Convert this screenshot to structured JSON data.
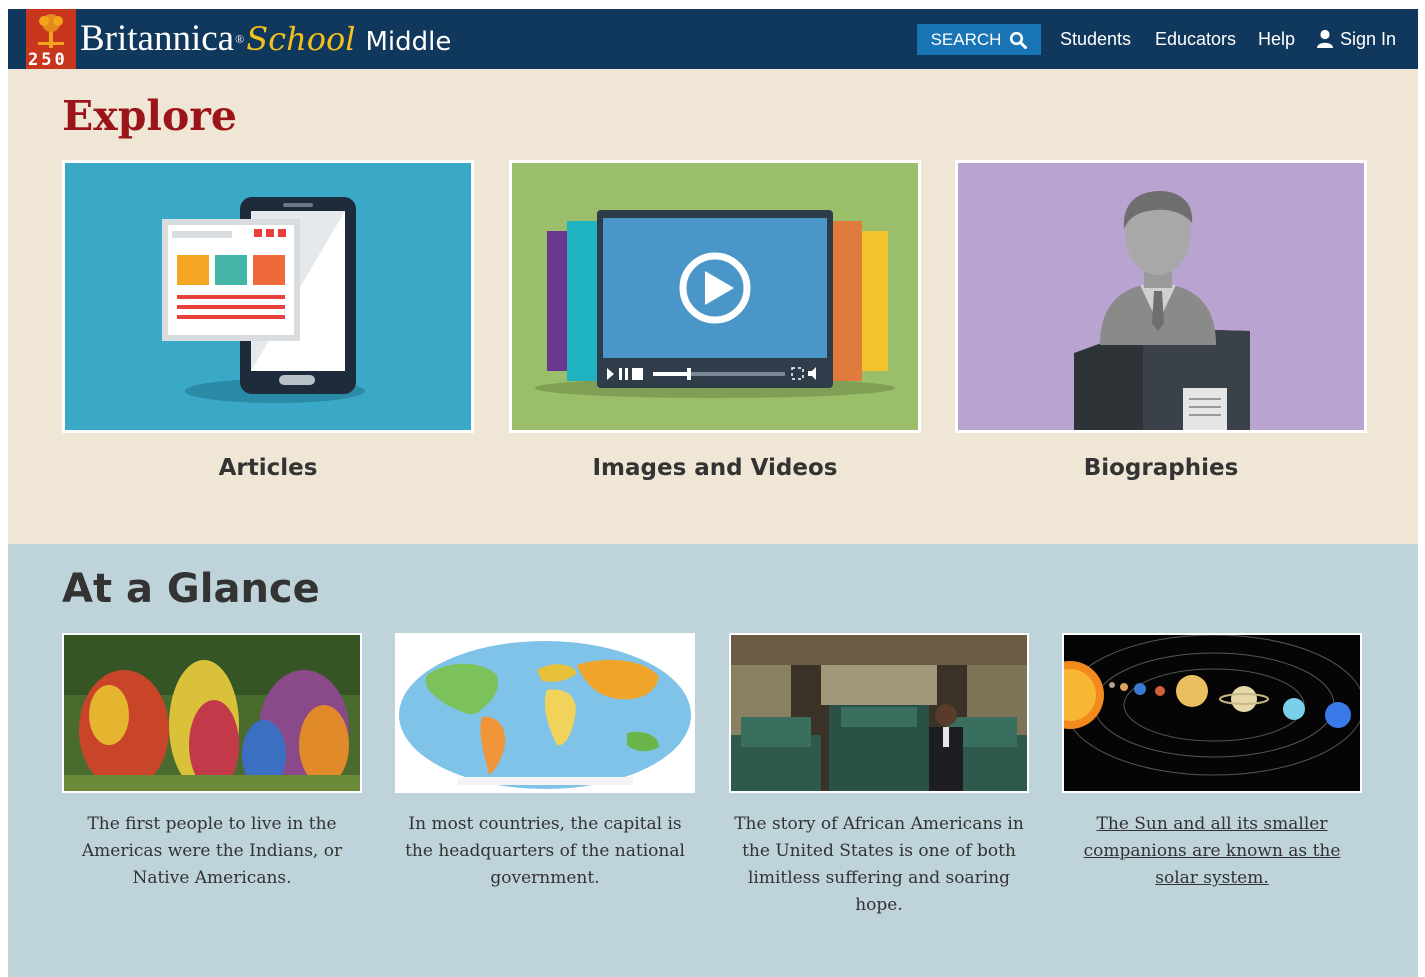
{
  "header": {
    "logo_number": "250",
    "brand_name": "Britannica",
    "brand_school": "School",
    "brand_level": "Middle",
    "search_label": "SEARCH",
    "nav": [
      {
        "label": "Students"
      },
      {
        "label": "Educators"
      },
      {
        "label": "Help"
      },
      {
        "label": "Sign In"
      }
    ]
  },
  "explore": {
    "title": "Explore",
    "cards": [
      {
        "label": "Articles",
        "bg": "#3aa9c8"
      },
      {
        "label": "Images and Videos",
        "bg": "#9bbe6a"
      },
      {
        "label": "Biographies",
        "bg": "#b8a3d1"
      }
    ]
  },
  "glance": {
    "title": "At a Glance",
    "cards": [
      {
        "caption": "The first people to live in the Americas were the Indians, or Native Americans."
      },
      {
        "caption": "In most countries, the capital is the headquarters of the national government."
      },
      {
        "caption": "The story of African Americans in the United States is one of both limitless suffering and soaring hope."
      },
      {
        "caption": "The Sun and all its smaller companions are known as the solar system."
      }
    ]
  },
  "colors": {
    "header_bg": "#10385c",
    "search_bg": "#1874b5",
    "explore_bg": "#efe6d6",
    "explore_title": "#9b1518",
    "glance_bg": "#bfd3da"
  }
}
